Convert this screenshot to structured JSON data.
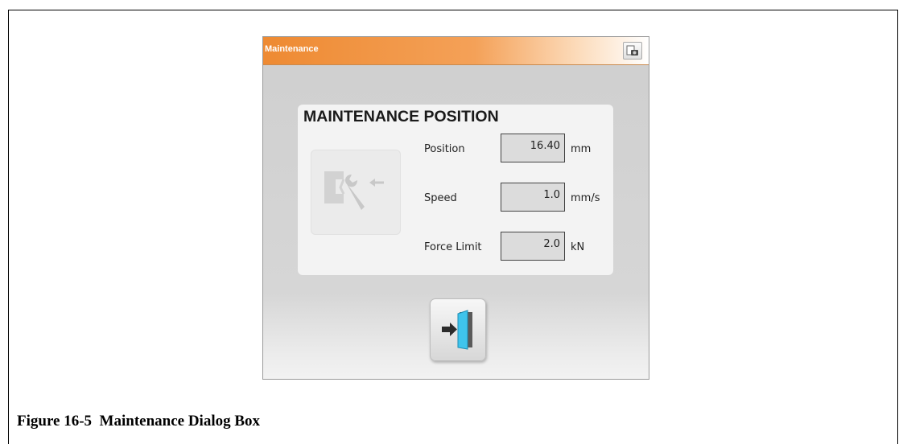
{
  "window": {
    "title": "Maintenance",
    "title_button_icon": "screenshot-camera-icon",
    "titlebar_color": "#f0923d"
  },
  "panel": {
    "title": "MAINTENANCE POSITION",
    "tool_icon": "maintenance-wrench-icon",
    "rows": [
      {
        "label": "Position",
        "value": "16.40",
        "unit": "mm"
      },
      {
        "label": "Speed",
        "value": "1.0",
        "unit": "mm/s"
      },
      {
        "label": "Force Limit",
        "value": "2.0",
        "unit": "kN"
      }
    ]
  },
  "exit_button": {
    "icon": "exit-door-icon",
    "accent": "#3fc4ec"
  },
  "caption": "Figure 16-5  Maintenance Dialog Box"
}
